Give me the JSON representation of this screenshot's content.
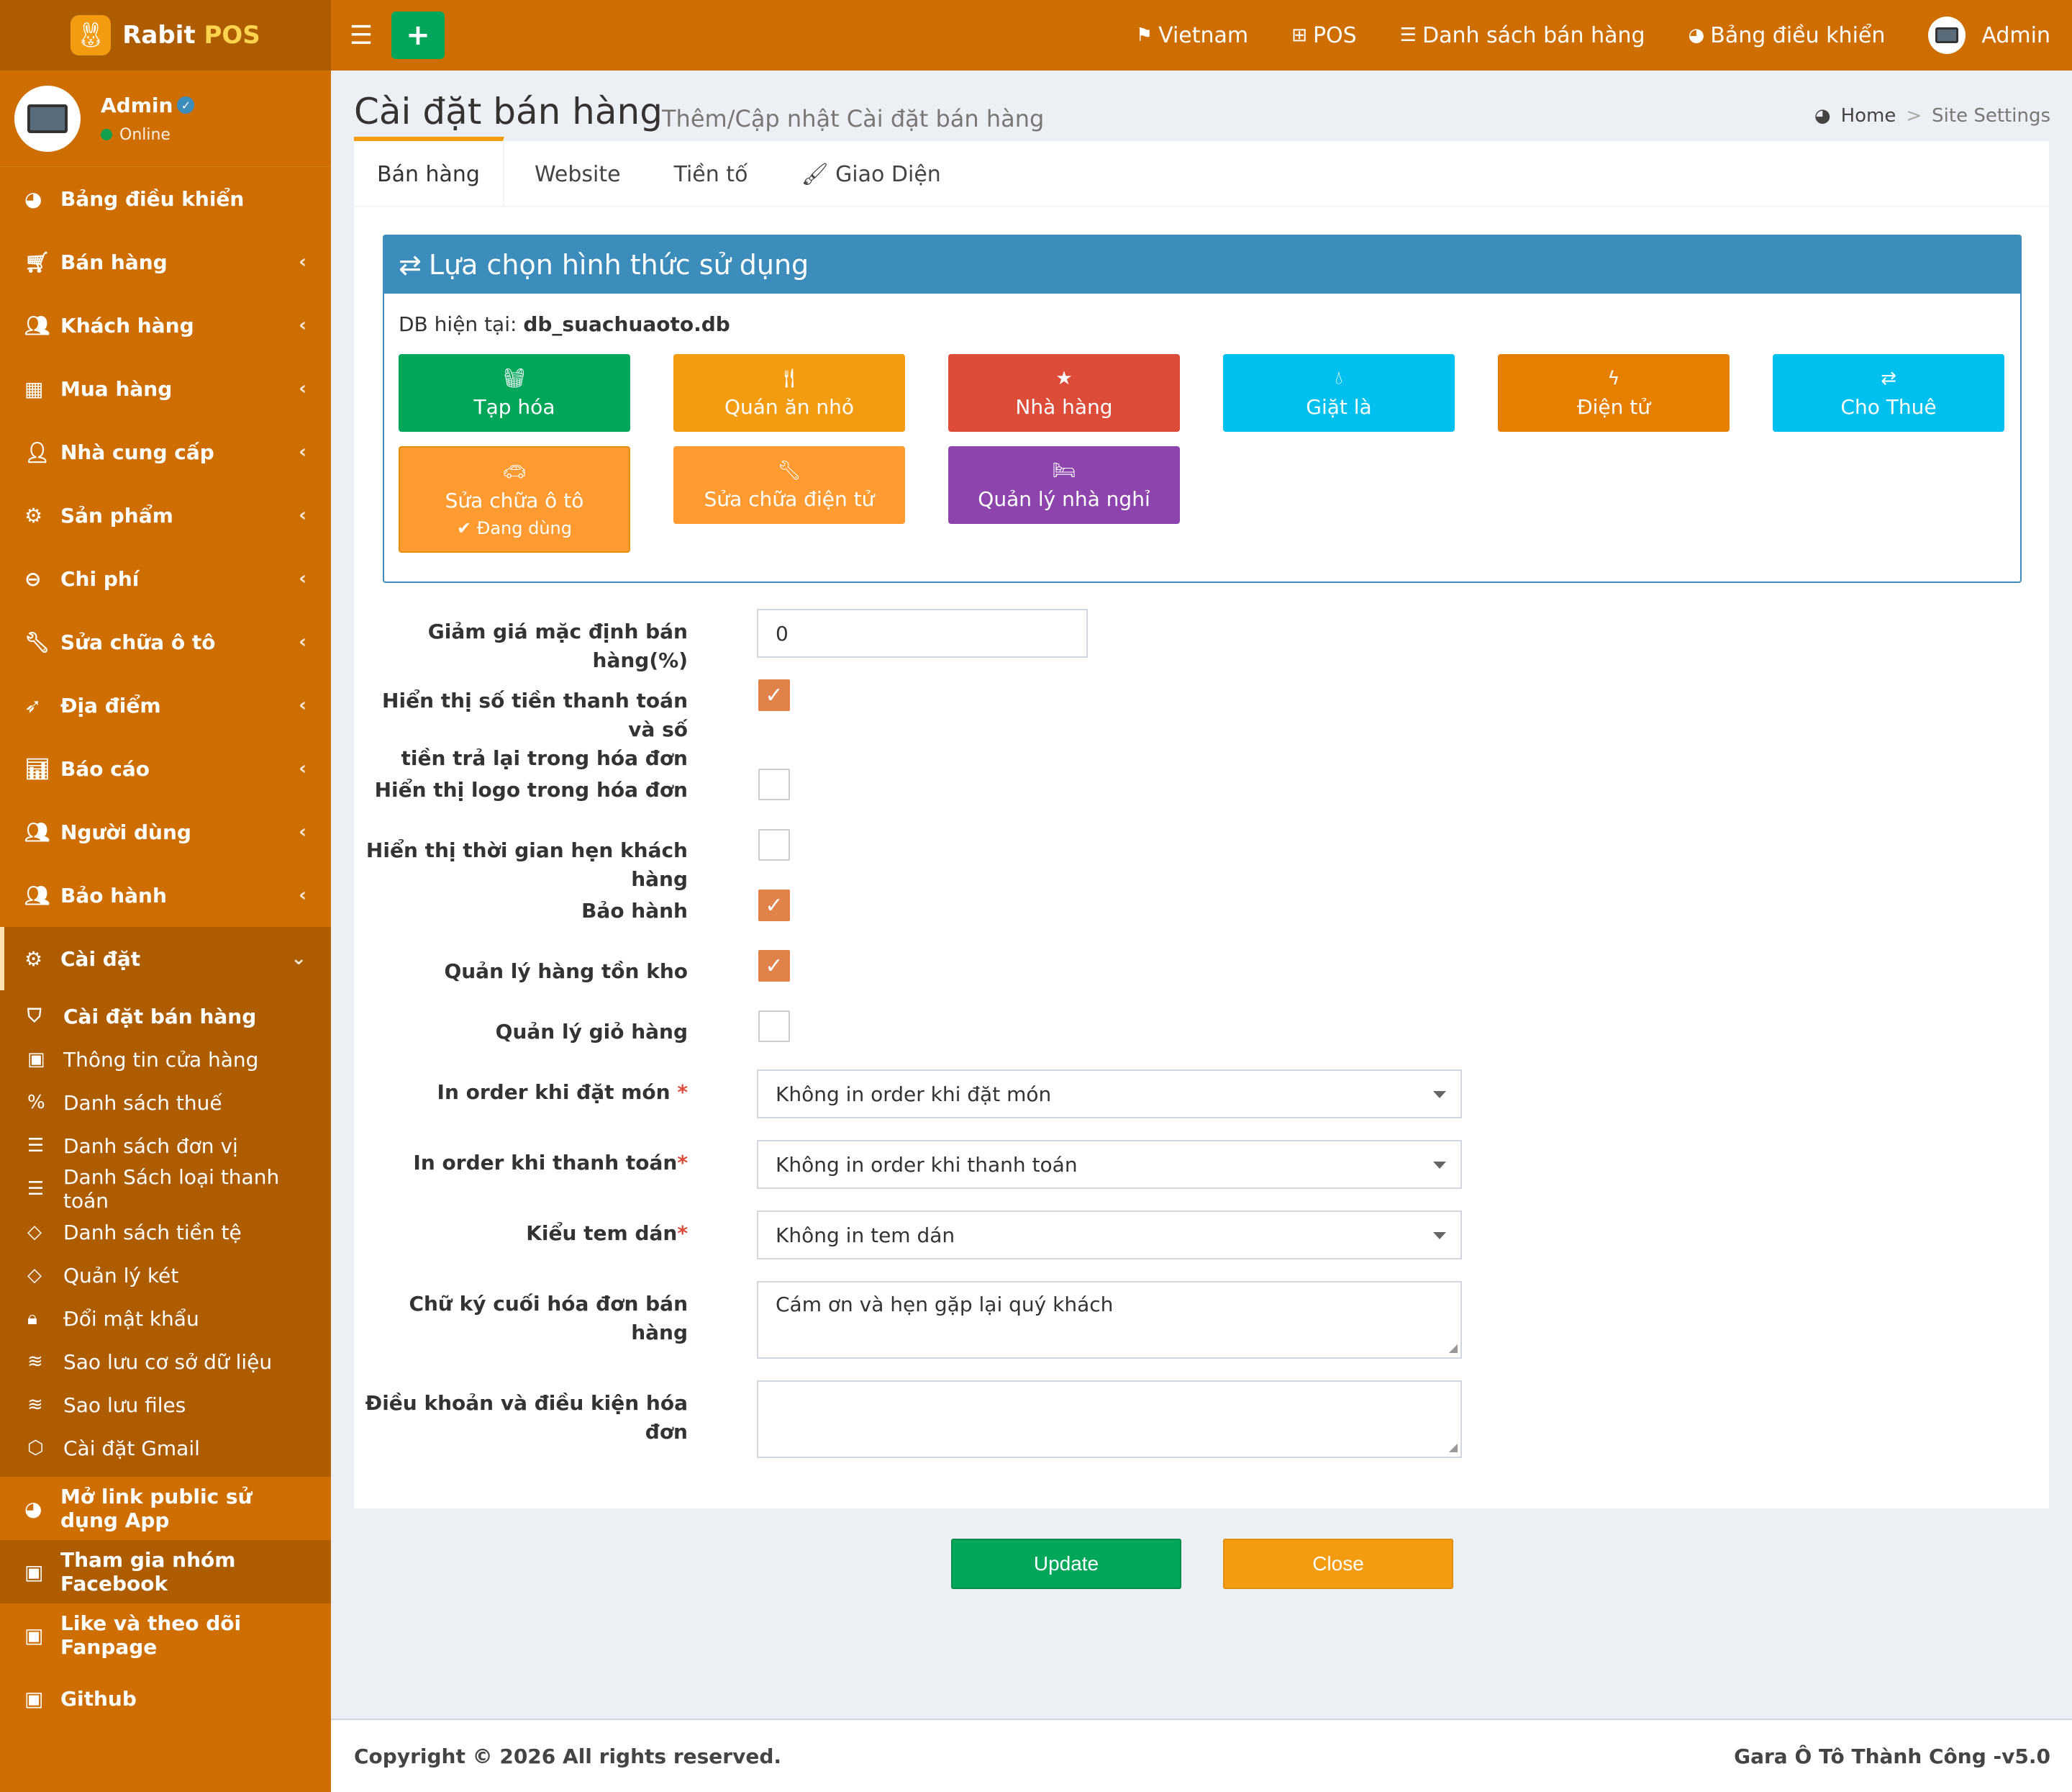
{
  "brand": {
    "name": "Rabit",
    "suffix": "POS"
  },
  "user": {
    "name": "Admin",
    "status": "Online"
  },
  "sidebar": {
    "items": [
      {
        "label": "Bảng điều khiển",
        "icon": "◕"
      },
      {
        "label": "Bán hàng",
        "icon": "🛒︎"
      },
      {
        "label": "Khách hàng",
        "icon": "👥︎"
      },
      {
        "label": "Mua hàng",
        "icon": "▦"
      },
      {
        "label": "Nhà cung cấp",
        "icon": "👤︎"
      },
      {
        "label": "Sản phẩm",
        "icon": "⚙"
      },
      {
        "label": "Chi phí",
        "icon": "⊖"
      },
      {
        "label": "Sửa chữa ô tô",
        "icon": "🔧︎"
      },
      {
        "label": "Địa điểm",
        "icon": "➶"
      },
      {
        "label": "Báo cáo",
        "icon": "📊︎"
      },
      {
        "label": "Người dùng",
        "icon": "👥︎"
      },
      {
        "label": "Bảo hành",
        "icon": "👥︎"
      },
      {
        "label": "Cài đặt",
        "icon": "⚙"
      }
    ],
    "submenu": [
      {
        "label": "Cài đặt bán hàng",
        "icon": "⛉"
      },
      {
        "label": "Thông tin cửa hàng",
        "icon": "▣"
      },
      {
        "label": "Danh sách thuế",
        "icon": "%"
      },
      {
        "label": "Danh sách đơn vị",
        "icon": "☰"
      },
      {
        "label": "Danh Sách loại thanh toán",
        "icon": "☰"
      },
      {
        "label": "Danh sách tiền tệ",
        "icon": "◇"
      },
      {
        "label": "Quản lý két",
        "icon": "◇"
      },
      {
        "label": "Đổi mật khẩu",
        "icon": "🔒︎"
      },
      {
        "label": "Sao lưu cơ sở dữ liệu",
        "icon": "≋"
      },
      {
        "label": "Sao lưu files",
        "icon": "≋"
      },
      {
        "label": "Cài đặt Gmail",
        "icon": "⬡"
      }
    ],
    "extra": [
      {
        "label": "Mở link public sử dụng App",
        "icon": "◕"
      },
      {
        "label": "Tham gia nhóm Facebook",
        "icon": "▣"
      },
      {
        "label": "Like và theo dõi Fanpage",
        "icon": "▣"
      },
      {
        "label": "Github",
        "icon": "▣"
      }
    ]
  },
  "navbar": {
    "links": [
      {
        "label": "Vietnam",
        "icon": "⚑"
      },
      {
        "label": "POS",
        "icon": "⊞"
      },
      {
        "label": "Danh sách bán hàng",
        "icon": "☰"
      },
      {
        "label": "Bảng điều khiển",
        "icon": "◕"
      }
    ],
    "user": "Admin"
  },
  "page": {
    "title": "Cài đặt bán hàng",
    "subtitle": "Thêm/Cập nhật Cài đặt bán hàng",
    "breadcrumb": {
      "home": "Home",
      "sep": ">",
      "current": "Site Settings"
    }
  },
  "tabs": [
    "Bán hàng",
    "Website",
    "Tiền tố",
    "Giao Diện"
  ],
  "mode_panel": {
    "title": "Lựa chọn hình thức sử dụng",
    "db_label": "DB hiện tại:",
    "db_name": "db_suachuaoto.db",
    "using_label": "✔ Đang dùng",
    "buttons": [
      {
        "label": "Tạp hóa",
        "icon": "🧺︎",
        "color": "#00a65a"
      },
      {
        "label": "Quán ăn nhỏ",
        "icon": "🍴︎",
        "color": "#f39c12"
      },
      {
        "label": "Nhà hàng",
        "icon": "★",
        "color": "#dd4b39"
      },
      {
        "label": "Giặt là",
        "icon": "💧︎",
        "color": "#00c0ef"
      },
      {
        "label": "Điện tử",
        "icon": "ϟ",
        "color": "#e67e00"
      },
      {
        "label": "Cho Thuê",
        "icon": "⇄",
        "color": "#00c0ef"
      },
      {
        "label": "Sửa chữa ô tô",
        "icon": "🚗︎",
        "color": "#ff9b30"
      },
      {
        "label": "Sửa chữa điện tử",
        "icon": "🔧︎",
        "color": "#ff9b30"
      },
      {
        "label": "Quản lý nhà nghỉ",
        "icon": "🛏︎",
        "color": "#8e44ad"
      }
    ]
  },
  "form": {
    "discount_label": "Giảm giá mặc định bán hàng(%)",
    "discount_value": "0",
    "show_paid_label": [
      "Hiển thị số tiền thanh toán và số",
      "tiền trả lại trong hóa đơn"
    ],
    "show_paid_checked": true,
    "show_logo_label": "Hiển thị logo trong hóa đơn",
    "show_logo_checked": false,
    "show_time_label": "Hiển thị thời gian hẹn khách hàng",
    "show_time_checked": false,
    "warranty_label": "Bảo hành",
    "warranty_checked": true,
    "inventory_label": "Quản lý hàng tồn kho",
    "inventory_checked": true,
    "cart_label": "Quản lý giỏ hàng",
    "cart_checked": false,
    "print_order_label": "In order khi đặt món",
    "print_order_value": "Không in order khi đặt món",
    "print_pay_label": "In order khi thanh toán",
    "print_pay_value": "Không in order khi thanh toán",
    "sticker_label": "Kiểu tem dán",
    "sticker_value": "Không in tem dán",
    "signature_label": "Chữ ký cuối hóa đơn bán hàng",
    "signature_value": "Cám ơn và hẹn gặp lại quý khách",
    "terms_label": "Điều khoản và điều kiện hóa đơn",
    "terms_value": "",
    "required_mark": "*"
  },
  "actions": {
    "update": "Update",
    "close": "Close"
  },
  "footer": {
    "copyright": "Copyright © 2026 All rights reserved.",
    "version": "Gara Ô Tô Thành Công -v5.0"
  },
  "colors": {
    "primary": "#cf6e00",
    "dark": "#ad5c00",
    "panel": "#3c8dbc",
    "check": "#e0824a"
  }
}
